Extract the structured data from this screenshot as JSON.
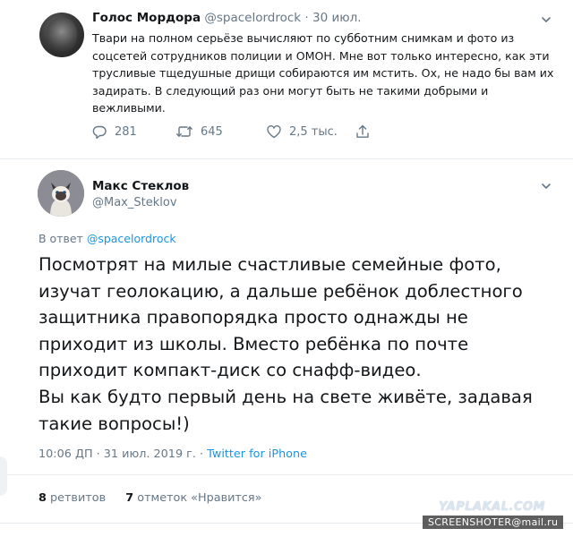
{
  "tweet1": {
    "name": "Голос Мордора",
    "handle": "@spacelordrock",
    "date": "· 30 июл.",
    "text": "Твари на полном серьёзе вычисляют по субботним снимкам и фото из соцсетей сотрудников полиции и ОМОН. Мне вот только интересно, как эти трусливые тщедушные дрищи собираются им мстить. Ох, не надо бы вам их задирать. В следующий раз они могут быть не такими добрыми и вежливыми.",
    "actions": {
      "replies": "281",
      "retweets": "645",
      "likes": "2,5 тыс."
    },
    "icons": [
      "reply-icon",
      "retweet-icon",
      "like-icon",
      "share-icon",
      "chevron-down-icon"
    ]
  },
  "tweet2": {
    "name": "Макс Стеклов",
    "handle": "@Max_Steklov",
    "reply_prefix": "В ответ",
    "reply_to": "@spacelordrock",
    "text_p1": "Посмотрят на милые счастливые семейные фото, изучат геолокацию, а дальше ребёнок доблестного защитника правопорядка просто однажды не приходит из школы. Вместо ребёнка по почте приходит компакт-диск со снафф-видео.",
    "text_p2": "Вы как будто первый день на свете живёте, задавая такие вопросы!)",
    "time_date": "10:06 ДП · 31 июл. 2019 г. ·",
    "source": "Twitter for iPhone",
    "retweets_count": "8",
    "retweets_label": "ретвитов",
    "likes_count": "7",
    "likes_label": "отметок «Нравится»"
  },
  "watermark": {
    "site": "YAPLAKAL.COM",
    "tool": "SCREENSHOTER@mail.ru"
  },
  "colors": {
    "text": "#14171a",
    "muted": "#657786",
    "link": "#1b95e0",
    "divider": "#e6ecf0"
  }
}
